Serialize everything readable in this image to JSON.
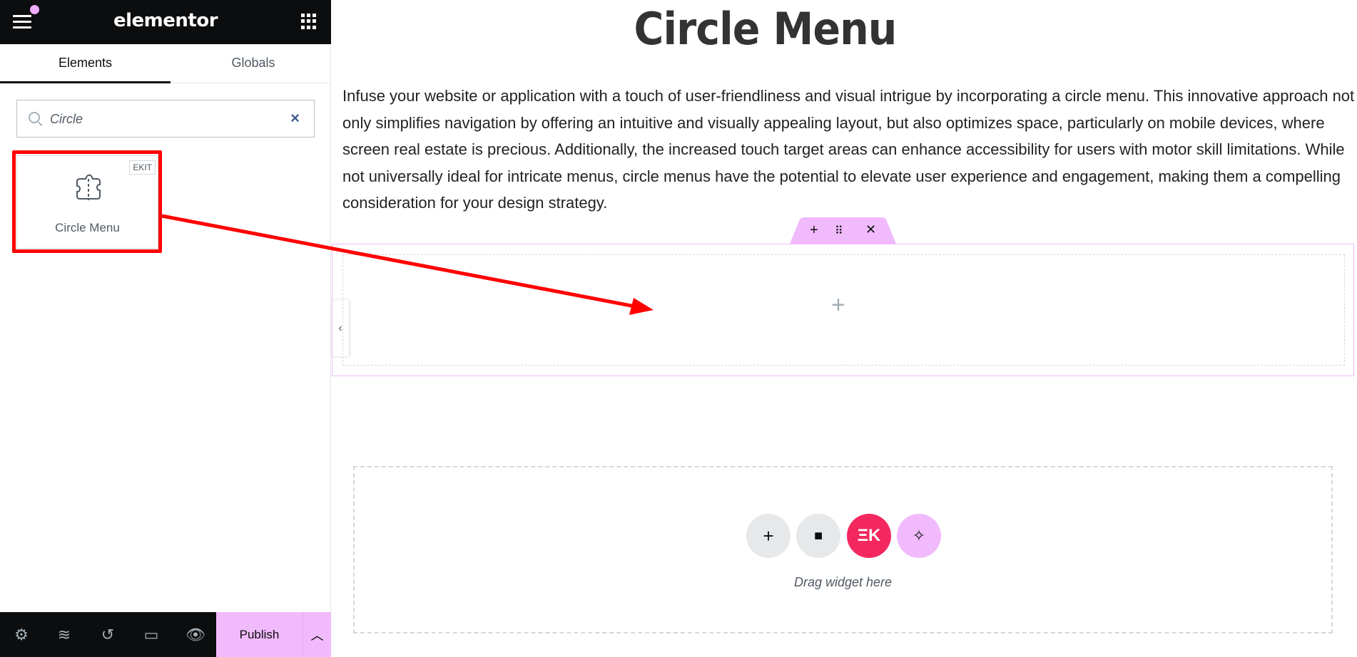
{
  "header": {
    "logo": "elementor",
    "menu_icon": "hamburger-icon",
    "apps_icon": "grid-icon",
    "notification_color": "#f0abfc"
  },
  "tabs": [
    {
      "label": "Elements",
      "active": true
    },
    {
      "label": "Globals",
      "active": false
    }
  ],
  "search": {
    "value": "Circle",
    "icon": "search-icon",
    "clear_icon": "close-icon"
  },
  "widget": {
    "label": "Circle Menu",
    "badge": "EKIT",
    "icon": "puzzle-circle-menu-icon"
  },
  "bottom": {
    "icons": [
      "gear-icon",
      "layers-icon",
      "history-icon",
      "responsive-icon",
      "eye-icon"
    ],
    "publish_label": "Publish",
    "more_icon": "chevron-up-icon",
    "publish_color": "#f0bafc"
  },
  "page": {
    "title": "Circle Menu",
    "paragraph": "Infuse your website or application with a touch of user-friendliness and visual intrigue by incorporating a circle menu. This innovative approach not only simplifies navigation by offering an intuitive and visually appealing layout, but also optimizes space, particularly on mobile devices, where screen real estate is precious. Additionally, the increased touch target areas can enhance accessibility for users with motor skill limitations. While not universally ideal for intricate menus, circle menus have the potential to elevate user experience and engagement, making them a compelling consideration for your design strategy."
  },
  "section_toolbar": {
    "add": "+",
    "drag": "⠿",
    "close": "✕"
  },
  "dropzone": {
    "hint": "Drag widget here",
    "buttons": [
      "add-section",
      "template-library",
      "elementskit",
      "ai-assistant"
    ],
    "ekit_color": "#f3285e",
    "ai_color": "#f0bafc"
  },
  "annotation": {
    "color": "#ff0000"
  }
}
